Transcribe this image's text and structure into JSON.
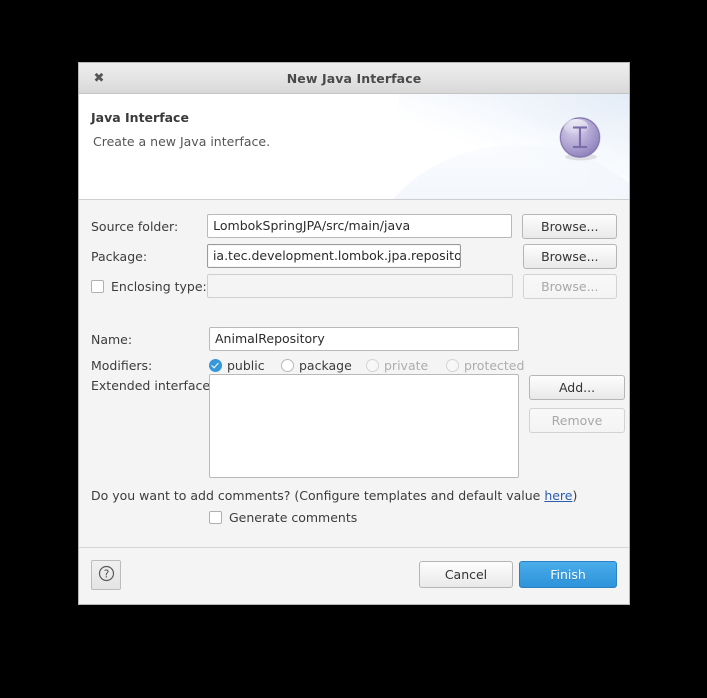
{
  "window": {
    "title": "New Java Interface",
    "close_icon": "close-icon"
  },
  "banner": {
    "title": "Java Interface",
    "subtitle": "Create a new Java interface.",
    "icon": "java-interface-icon",
    "icon_glyph": "I"
  },
  "form": {
    "source_folder": {
      "label": "Source folder:",
      "value": "LombokSpringJPA/src/main/java",
      "browse_label": "Browse..."
    },
    "package": {
      "label": "Package:",
      "value": "ia.tec.development.lombok.jpa.repository",
      "browse_label": "Browse..."
    },
    "enclosing_type": {
      "label": "Enclosing type:",
      "value": "",
      "browse_label": "Browse...",
      "checked": false
    },
    "name": {
      "label": "Name:",
      "value": "AnimalRepository"
    },
    "modifiers": {
      "label": "Modifiers:",
      "options": [
        {
          "label": "public",
          "selected": true,
          "enabled": true
        },
        {
          "label": "package",
          "selected": false,
          "enabled": true
        },
        {
          "label": "private",
          "selected": false,
          "enabled": false
        },
        {
          "label": "protected",
          "selected": false,
          "enabled": false
        }
      ]
    },
    "extended_interfaces": {
      "label": "Extended interfaces:",
      "items": [],
      "add_label": "Add...",
      "remove_label": "Remove"
    },
    "comments": {
      "question_prefix": "Do you want to add comments? (Configure templates and default value ",
      "link_text": "here",
      "question_suffix": ")",
      "checkbox_label": "Generate comments",
      "checked": false
    }
  },
  "footer": {
    "help_icon": "help-icon",
    "cancel_label": "Cancel",
    "finish_label": "Finish"
  },
  "colors": {
    "accent": "#3498db",
    "finish_button": "#3b9fe2",
    "link": "#2a5db0",
    "dialog_bg": "#f4f4f4"
  }
}
